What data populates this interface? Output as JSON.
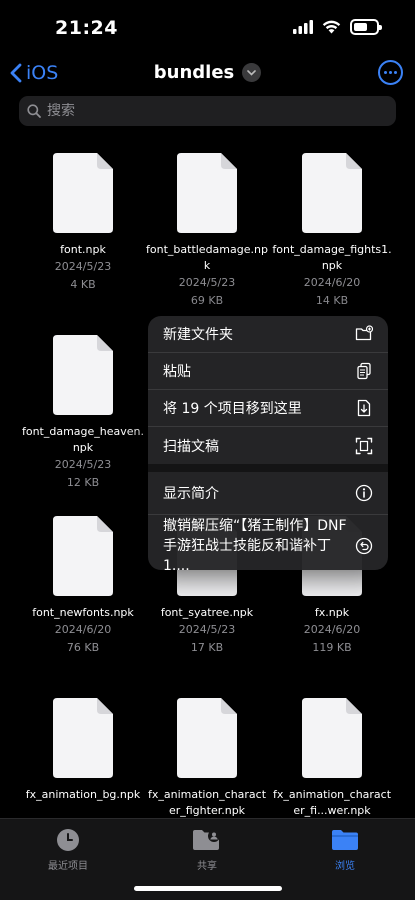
{
  "status": {
    "time": "21:24"
  },
  "nav": {
    "back_label": "iOS",
    "title": "bundles"
  },
  "search": {
    "placeholder": "搜索"
  },
  "files": [
    {
      "name": "font.npk",
      "date": "2024/5/23",
      "size": "4 KB"
    },
    {
      "name": "font_battledamage.npk",
      "date": "2024/5/23",
      "size": "69 KB"
    },
    {
      "name": "font_damage_fights1.npk",
      "date": "2024/6/20",
      "size": "14 KB"
    },
    {
      "name": "font_damage_heaven.npk",
      "date": "2024/5/23",
      "size": "12 KB"
    },
    {
      "name": "font_newfonts.npk",
      "date": "2024/6/20",
      "size": "76 KB"
    },
    {
      "name": "font_syatree.npk",
      "date": "2024/5/23",
      "size": "17 KB"
    },
    {
      "name": "fx.npk",
      "date": "2024/6/20",
      "size": "119 KB"
    },
    {
      "name": "fx_animation_bg.npk"
    },
    {
      "name": "fx_animation_character_fighter.npk"
    },
    {
      "name": "fx_animation_character_fi...wer.npk"
    }
  ],
  "menu": {
    "new_folder": "新建文件夹",
    "paste": "粘贴",
    "move_items": "将 19 个项目移到这里",
    "scan_documents": "扫描文稿",
    "show_info": "显示简介",
    "undo_unzip": "撤销解压缩“【猪王制作】DNF手游狂战士技能反和谐补丁1...."
  },
  "tabs": {
    "recents": "最近项目",
    "shared": "共享",
    "browse": "浏览"
  },
  "colors": {
    "accent": "#3b82f6",
    "background": "#000000",
    "secondary_text": "#8e8e93"
  }
}
